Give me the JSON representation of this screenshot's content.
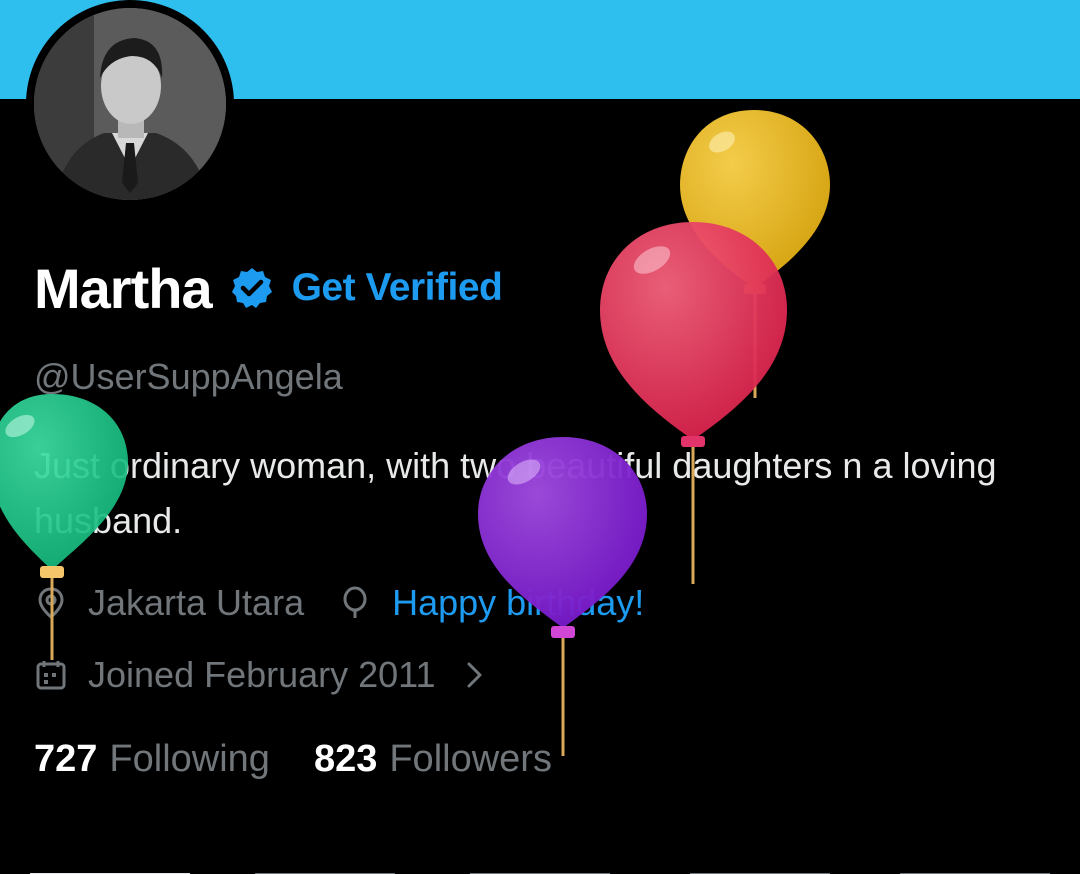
{
  "profile": {
    "display_name": "Martha",
    "get_verified_label": "Get Verified",
    "handle": "@UserSuppAngela",
    "bio": "Just ordinary woman, with two beautiful daughters n a loving husband.",
    "location": "Jakarta Utara",
    "birthday": "Happy birthday!",
    "joined": "Joined February 2011",
    "following_count": "727",
    "following_label": "Following",
    "followers_count": "823",
    "followers_label": "Followers"
  },
  "icons": {
    "verified": "verified-badge-icon",
    "location": "location-pin-icon",
    "birthday": "balloon-icon",
    "calendar": "calendar-icon",
    "chevron": "chevron-right-icon"
  },
  "colors": {
    "banner": "#2fbfef",
    "accent": "#1d9bf0",
    "background": "#000000",
    "muted_text": "#71767b",
    "primary_text": "#e7e9ea"
  }
}
